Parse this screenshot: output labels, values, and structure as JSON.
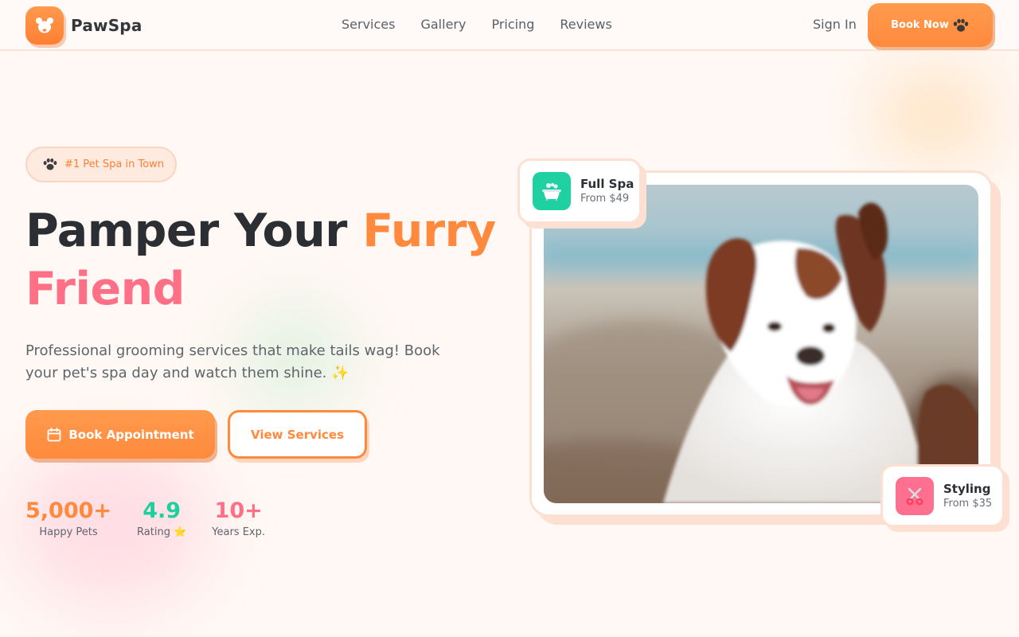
{
  "brand": {
    "name": "PawSpa",
    "logo_icon": "paw-face-icon"
  },
  "nav": {
    "links": [
      "Services",
      "Gallery",
      "Pricing",
      "Reviews"
    ],
    "sign_in": "Sign In",
    "cta": "Book Now",
    "cta_icon": "paw-icon"
  },
  "hero": {
    "tag": "#1 Pet Spa in Town",
    "title_part1": "Pamper Your ",
    "title_highlight1": "Furry",
    "title_highlight2": "Friend",
    "description": "Professional grooming services that make tails wag! Book your pet's spa day and watch them shine. ✨",
    "primary_cta": "Book Appointment",
    "secondary_cta": "View Services",
    "stats": [
      {
        "value": "5,000+",
        "label": "Happy Pets",
        "color": "#ff8a3d"
      },
      {
        "value": "4.9",
        "label": "Rating ⭐",
        "color": "#1fcf9e"
      },
      {
        "value": "10+",
        "label": "Years Exp.",
        "color": "#ff6f86"
      }
    ]
  },
  "cards": {
    "spa": {
      "title": "Full Spa",
      "price": "From $49",
      "icon": "bathtub-icon",
      "color": "#1fd1a0"
    },
    "styling": {
      "title": "Styling",
      "price": "From $35",
      "icon": "scissors-icon",
      "color": "#ff6f8f"
    }
  },
  "colors": {
    "accent": "#ff8a3d",
    "pink": "#ff6f86",
    "green": "#1fcf9e",
    "background": "#fff8f4"
  }
}
